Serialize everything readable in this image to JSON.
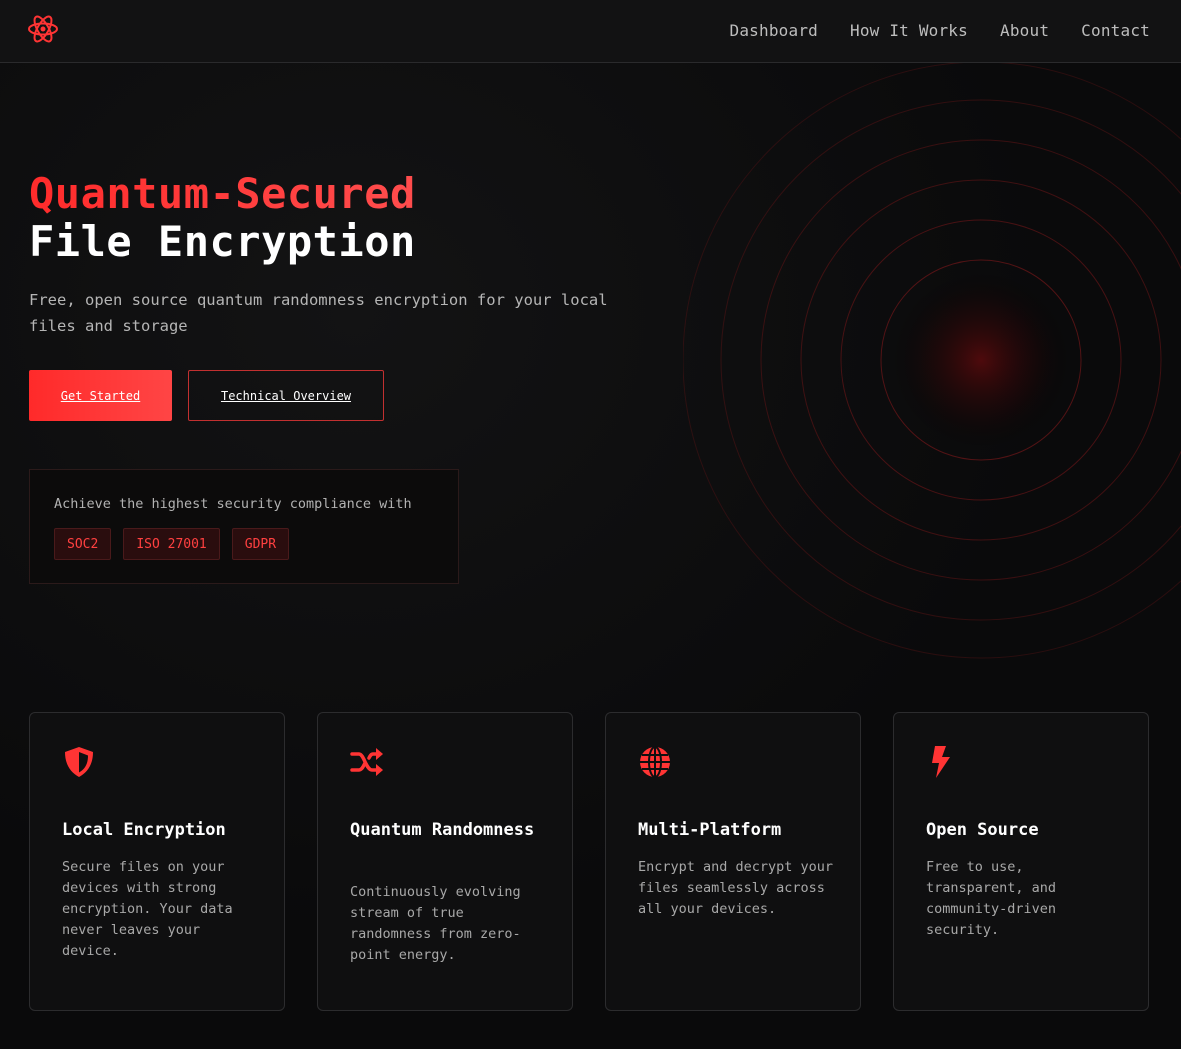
{
  "colors": {
    "accent": "#ff3434",
    "background": "#0a0a0b",
    "nav": "#121213"
  },
  "nav": {
    "logo_icon": "atom-icon",
    "links": [
      "Dashboard",
      "How It Works",
      "About",
      "Contact"
    ]
  },
  "hero": {
    "title_line1": "Quantum-Secured",
    "title_line2": "File Encryption",
    "subtitle": "Free, open source quantum randomness encryption for your local files and storage",
    "primary_button": "Get Started",
    "secondary_button": "Technical Overview"
  },
  "compliance": {
    "text": "Achieve the highest security compliance with",
    "badges": [
      "SOC2",
      "ISO 27001",
      "GDPR"
    ]
  },
  "features": [
    {
      "icon": "shield-icon",
      "title": "Local Encryption",
      "description": "Secure files on your devices with strong encryption. Your data never leaves your device."
    },
    {
      "icon": "shuffle-icon",
      "title": "Quantum Randomness",
      "description": "Continuously evolving stream of true randomness from zero-point energy."
    },
    {
      "icon": "globe-icon",
      "title": "Multi-Platform",
      "description": "Encrypt and decrypt your files seamlessly across all your devices."
    },
    {
      "icon": "bolt-icon",
      "title": "Open Source",
      "description": "Free to use, transparent, and community-driven security."
    }
  ]
}
